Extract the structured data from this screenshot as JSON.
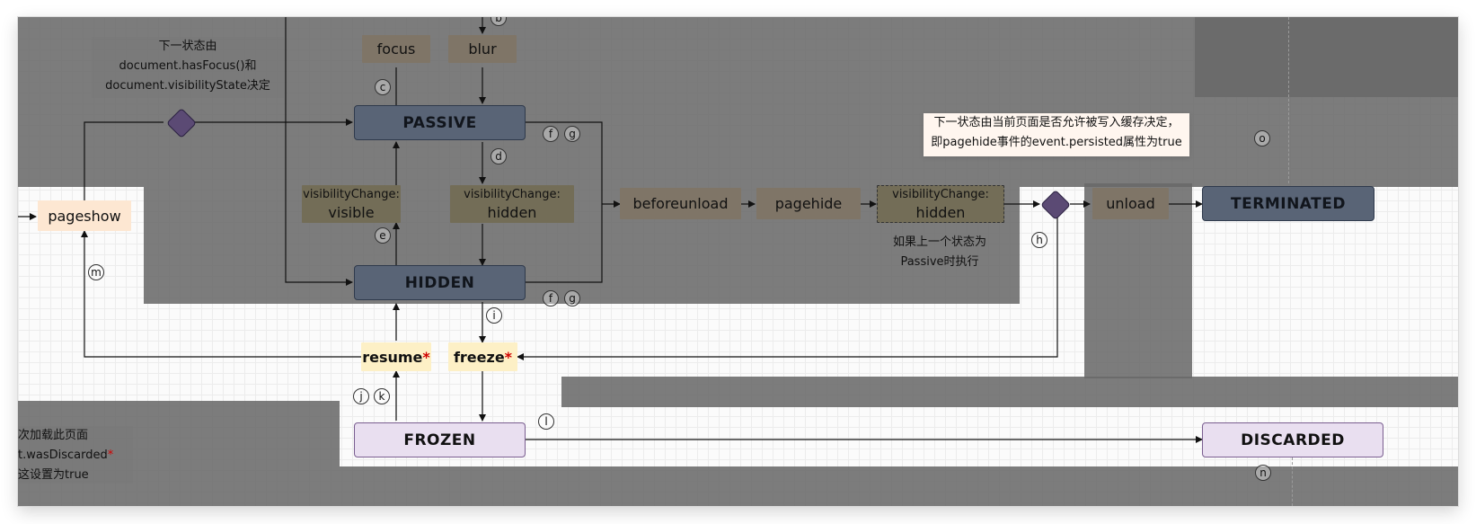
{
  "states": {
    "passive": "PASSIVE",
    "hidden": "HIDDEN",
    "terminated": "TERMINATED",
    "frozen": "FROZEN",
    "discarded": "DISCARDED"
  },
  "events": {
    "focus": "focus",
    "blur": "blur",
    "pageshow": "pageshow",
    "visible_top": "visibilityChange:",
    "visible_bottom": "visible",
    "hidden_top": "visibilityChange:",
    "hidden_bottom": "hidden",
    "beforeunload": "beforeunload",
    "pagehide": "pagehide",
    "pagehide_vis_top": "visibilityChange:",
    "pagehide_vis_bottom": "hidden",
    "unload": "unload",
    "resume": "resume",
    "freeze": "freeze",
    "star": "*"
  },
  "notes": {
    "focus_note": [
      "下一状态由",
      "document.hasFocus()和",
      "document.visibilityState决定"
    ],
    "cache_note": [
      "下一状态由当前页面是否允许被写入缓存决定，",
      "即pagehide事件的event.persisted属性为true"
    ],
    "passive_note": [
      "如果上一个状态为",
      "Passive时执行"
    ],
    "discard_note_1": "次加载此页面",
    "discard_note_2": "t.wasDiscarded",
    "discard_note_3": "这设置为true"
  },
  "badges": {
    "b": "b",
    "c": "c",
    "d": "d",
    "e": "e",
    "f": "f",
    "g": "g",
    "h": "h",
    "i": "i",
    "j": "j",
    "k": "k",
    "l": "l",
    "m": "m",
    "n": "n",
    "o": "o"
  },
  "colors": {
    "shade": "#696969",
    "state_blue": "#596476",
    "state_purple": "#e9dff0",
    "event_brown": "#7f7567",
    "event_gold": "#736d57",
    "event_peach": "#fde7d2",
    "event_yellow": "#fdf0c6",
    "star_red": "#d10000",
    "diamond": "#5b4a74"
  }
}
